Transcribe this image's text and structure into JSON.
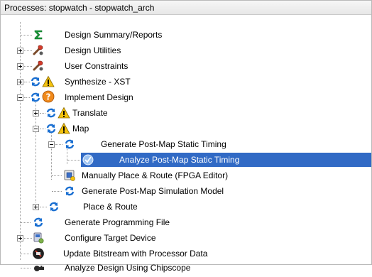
{
  "header": {
    "title": "Processes: stopwatch - stopwatch_arch"
  },
  "tree": {
    "items": [
      {
        "label": "Design Summary/Reports"
      },
      {
        "label": "Design Utilities"
      },
      {
        "label": "User Constraints"
      },
      {
        "label": "Synthesize - XST"
      },
      {
        "label": "Implement Design"
      },
      {
        "label": "Translate"
      },
      {
        "label": "Map"
      },
      {
        "label": "Generate Post-Map Static Timing"
      },
      {
        "label": "Analyze Post-Map Static Timing"
      },
      {
        "label": "Manually Place & Route (FPGA Editor)"
      },
      {
        "label": "Generate Post-Map Simulation Model"
      },
      {
        "label": "Place & Route"
      },
      {
        "label": "Generate Programming File"
      },
      {
        "label": "Configure Target Device"
      },
      {
        "label": "Update Bitstream with Processor Data"
      },
      {
        "label": "Analyze Design Using Chipscope"
      }
    ]
  },
  "colors": {
    "selection": "#316ac5",
    "refresh_blue": "#1a6fd1",
    "warning_yellow": "#f4c20d",
    "error_orange": "#f08a1c"
  }
}
